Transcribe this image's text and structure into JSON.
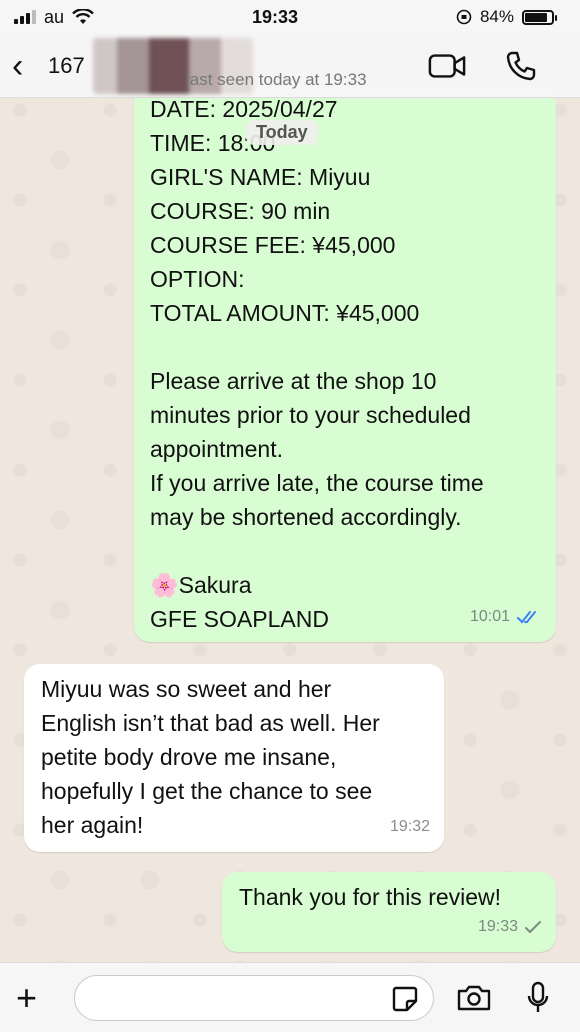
{
  "status": {
    "carrier": "au",
    "time": "19:33",
    "battery": "84%"
  },
  "header": {
    "contact": "167",
    "last_seen": "last seen today at 19:33"
  },
  "today_chip": "Today",
  "messages": [
    {
      "lines": [
        "DATE: 2025/04/27",
        "TIME: 18:00",
        "GIRL'S NAME: Miyuu",
        "COURSE: 90 min",
        "COURSE FEE: ¥45,000",
        "OPTION:",
        "TOTAL AMOUNT: ¥45,000",
        "",
        "Please arrive at the shop 10",
        "minutes prior to your scheduled",
        "appointment.",
        "If you arrive late, the course time",
        "may be shortened accordingly.",
        "",
        "🌸Sakura",
        "GFE SOAPLAND"
      ],
      "time": "10:01",
      "status": "read"
    },
    {
      "lines": [
        "Miyuu was so sweet and her",
        "English isn’t that bad as well. Her",
        "petite body drove me insane,",
        "hopefully I get the chance to see",
        "her again!"
      ],
      "time": "19:32"
    },
    {
      "lines": [
        "Thank you for this review!"
      ],
      "time": "19:33",
      "status": "sent"
    }
  ],
  "composer": {
    "placeholder": ""
  },
  "colors": {
    "outgoing": "#d9fdd3",
    "incoming": "#ffffff",
    "read_tick": "#3b82f6"
  }
}
